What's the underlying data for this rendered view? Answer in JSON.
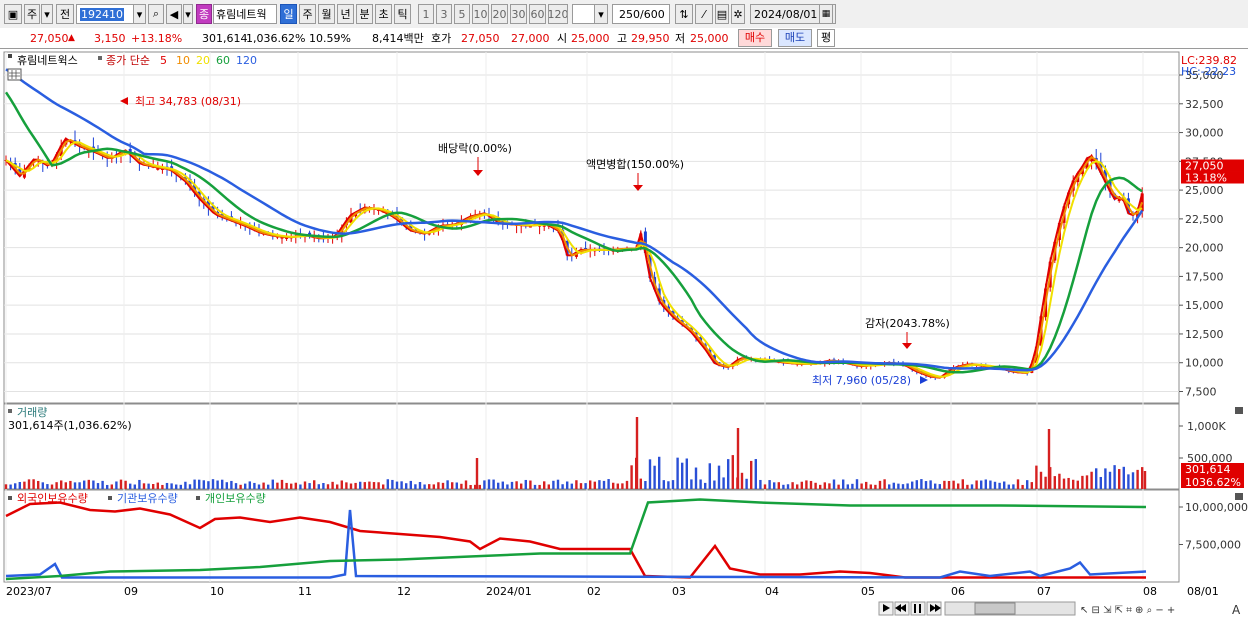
{
  "toolbar": {
    "period_type": "주",
    "range_type": "전",
    "code": "192410",
    "stock_name": "휴림네트웍",
    "period_buttons": [
      "일",
      "주",
      "월",
      "년",
      "분",
      "초",
      "틱"
    ],
    "interval_buttons": [
      "1",
      "3",
      "5",
      "10",
      "20",
      "30",
      "60",
      "120"
    ],
    "count_value": "250",
    "count_total": "/600",
    "date": "2024/08/01"
  },
  "quote": {
    "price": "27,050",
    "change": "3,150",
    "change_pct": "+13.18%",
    "volume": "301,614",
    "volume_ratio": "1,036.62%",
    "turnover": "10.59%",
    "amount": "8,414백만",
    "hoga_label": "호가",
    "bid": "27,050",
    "ask": "27,000",
    "open_label": "시",
    "open": "25,000",
    "high_label": "고",
    "high": "29,950",
    "low_label": "저",
    "low": "25,000",
    "buy_label": "매수",
    "sell_label": "매도",
    "eval_label": "평"
  },
  "legend": {
    "name": "휴림네트윅스",
    "price_type": "종가 단순",
    "ma_periods": [
      "5",
      "10",
      "20",
      "60",
      "120"
    ]
  },
  "chart_data": {
    "type": "candlestick",
    "xlabels": [
      "2023/07",
      "09",
      "10",
      "11",
      "12",
      "2024/01",
      "02",
      "03",
      "04",
      "05",
      "06",
      "07",
      "08",
      "08/01"
    ],
    "price_axis": {
      "ticks": [
        "35,000",
        "32,500",
        "30,000",
        "27,500",
        "25,000",
        "22,500",
        "20,000",
        "17,500",
        "15,000",
        "12,500",
        "10,000",
        "7,500"
      ],
      "lc": "LC:239.82",
      "hc": "HC:-22.23",
      "last_price": "27,050",
      "last_pct": "13.18%",
      "ylim": [
        6500,
        37000
      ]
    },
    "annotations": {
      "high": "최고 34,783 (08/31)",
      "dividend": "배당락(0.00%)",
      "split": "액면병합(150.00%)",
      "reduction": "감자(2043.78%)",
      "low": "최저 7,960 (05/28)"
    },
    "ma": [
      {
        "period": "5",
        "color": "#e00000"
      },
      {
        "period": "10",
        "color": "#f08c00"
      },
      {
        "period": "20",
        "color": "#f0e000"
      },
      {
        "period": "60",
        "color": "#16a03c"
      },
      {
        "period": "120",
        "color": "#2a5ee0"
      }
    ],
    "volume_panel": {
      "title": "거래량",
      "value": "301,614주(1,036.62%)",
      "ticks": [
        "1,000K",
        "500,000"
      ],
      "last": "301,614",
      "last_pct": "1036.62%"
    },
    "holdings_panel": {
      "series": [
        "외국인보유수량",
        "기관보유수량",
        "개인보유수량"
      ],
      "colors": [
        "#e00000",
        "#2a5ee0",
        "#16a03c"
      ],
      "ticks": [
        "10,000,000",
        "7,500,000"
      ]
    }
  }
}
